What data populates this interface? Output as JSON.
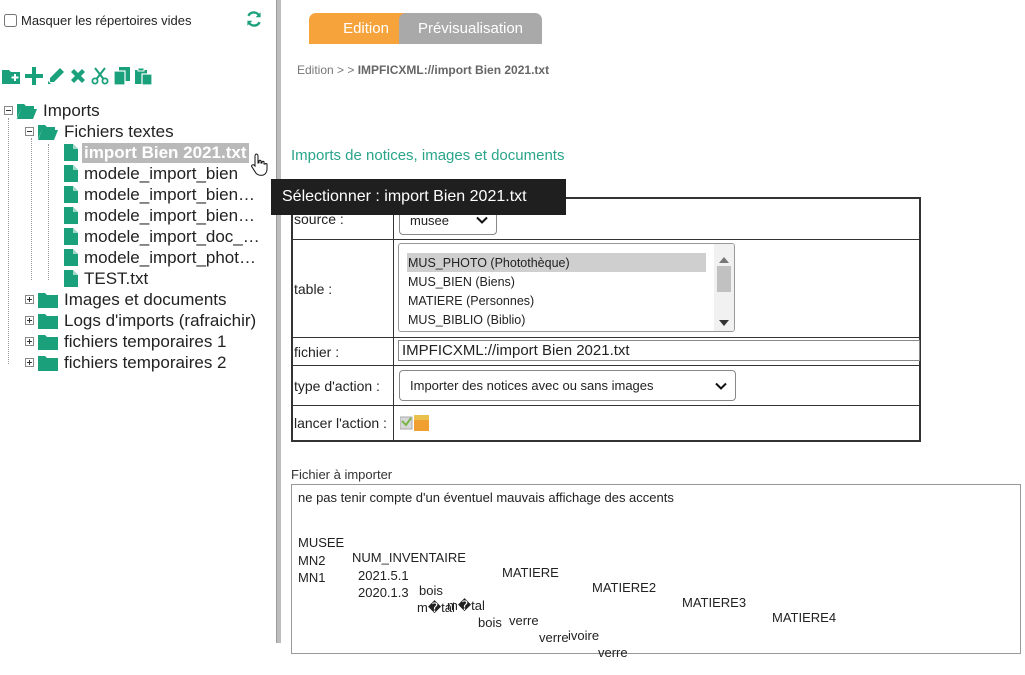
{
  "left_panel": {
    "hide_empty_label": "Masquer les répertoires vides",
    "hide_empty_checked": false,
    "toolbar": [
      "new-folder-icon",
      "add-icon",
      "edit-icon",
      "delete-icon",
      "cut-icon",
      "copy-icon",
      "paste-icon"
    ],
    "tree": {
      "root": "Imports",
      "group_1": "Fichiers textes",
      "files": [
        "import Bien 2021.txt",
        "modele_import_bien",
        "modele_import_bien…",
        "modele_import_bien…",
        "modele_import_doc_…",
        "modele_import_phot…",
        "TEST.txt"
      ],
      "folders": [
        "Images et documents",
        "Logs d'imports (rafraichir)",
        "fichiers temporaires 1",
        "fichiers temporaires 2"
      ]
    }
  },
  "tabs": {
    "edit": "Edition",
    "preview": "Prévisualisation"
  },
  "breadcrumb": {
    "prefix": "Edition > > ",
    "current": "IMPFICXML://import Bien 2021.txt"
  },
  "tooltip": "Sélectionner : import Bien 2021.txt",
  "section_title": "Imports de notices, images et documents",
  "form": {
    "source_label": "source :",
    "source_value": "musee",
    "table_label": "table :",
    "table_options": [
      "MUS_PHOTO (Photothèque)",
      "MUS_BIEN (Biens)",
      "MATIERE (Personnes)",
      "MUS_BIBLIO (Biblio)"
    ],
    "table_selected": "MUS_PHOTO (Photothèque)",
    "fichier_label": "fichier :",
    "fichier_value": "IMPFICXML://import Bien 2021.txt",
    "action_type_label": "type d'action :",
    "action_type_value": "Importer des notices avec ou sans images",
    "run_label": "lancer l'action :"
  },
  "file_content": {
    "label": "Fichier à importer",
    "note": "ne pas tenir compte d'un éventuel mauvais affichage des accents",
    "header": [
      "MUSEE",
      "NUM_INVENTAIRE",
      "MATIERE",
      "MATIERE2",
      "MATIERE3",
      "MATIERE4"
    ],
    "rows": [
      [
        "MN2",
        "2021.5.1",
        "bois",
        "m�tal",
        "verre",
        "ivoire"
      ],
      [
        "MN1",
        "2020.1.3",
        "m�tal",
        "bois",
        "verre",
        "verre"
      ]
    ]
  },
  "colors": {
    "accent_orange": "#f7a33c",
    "tab_grey": "#a9a9a9",
    "title_green": "#2aa58a",
    "icon_green": "#1aa07a"
  }
}
